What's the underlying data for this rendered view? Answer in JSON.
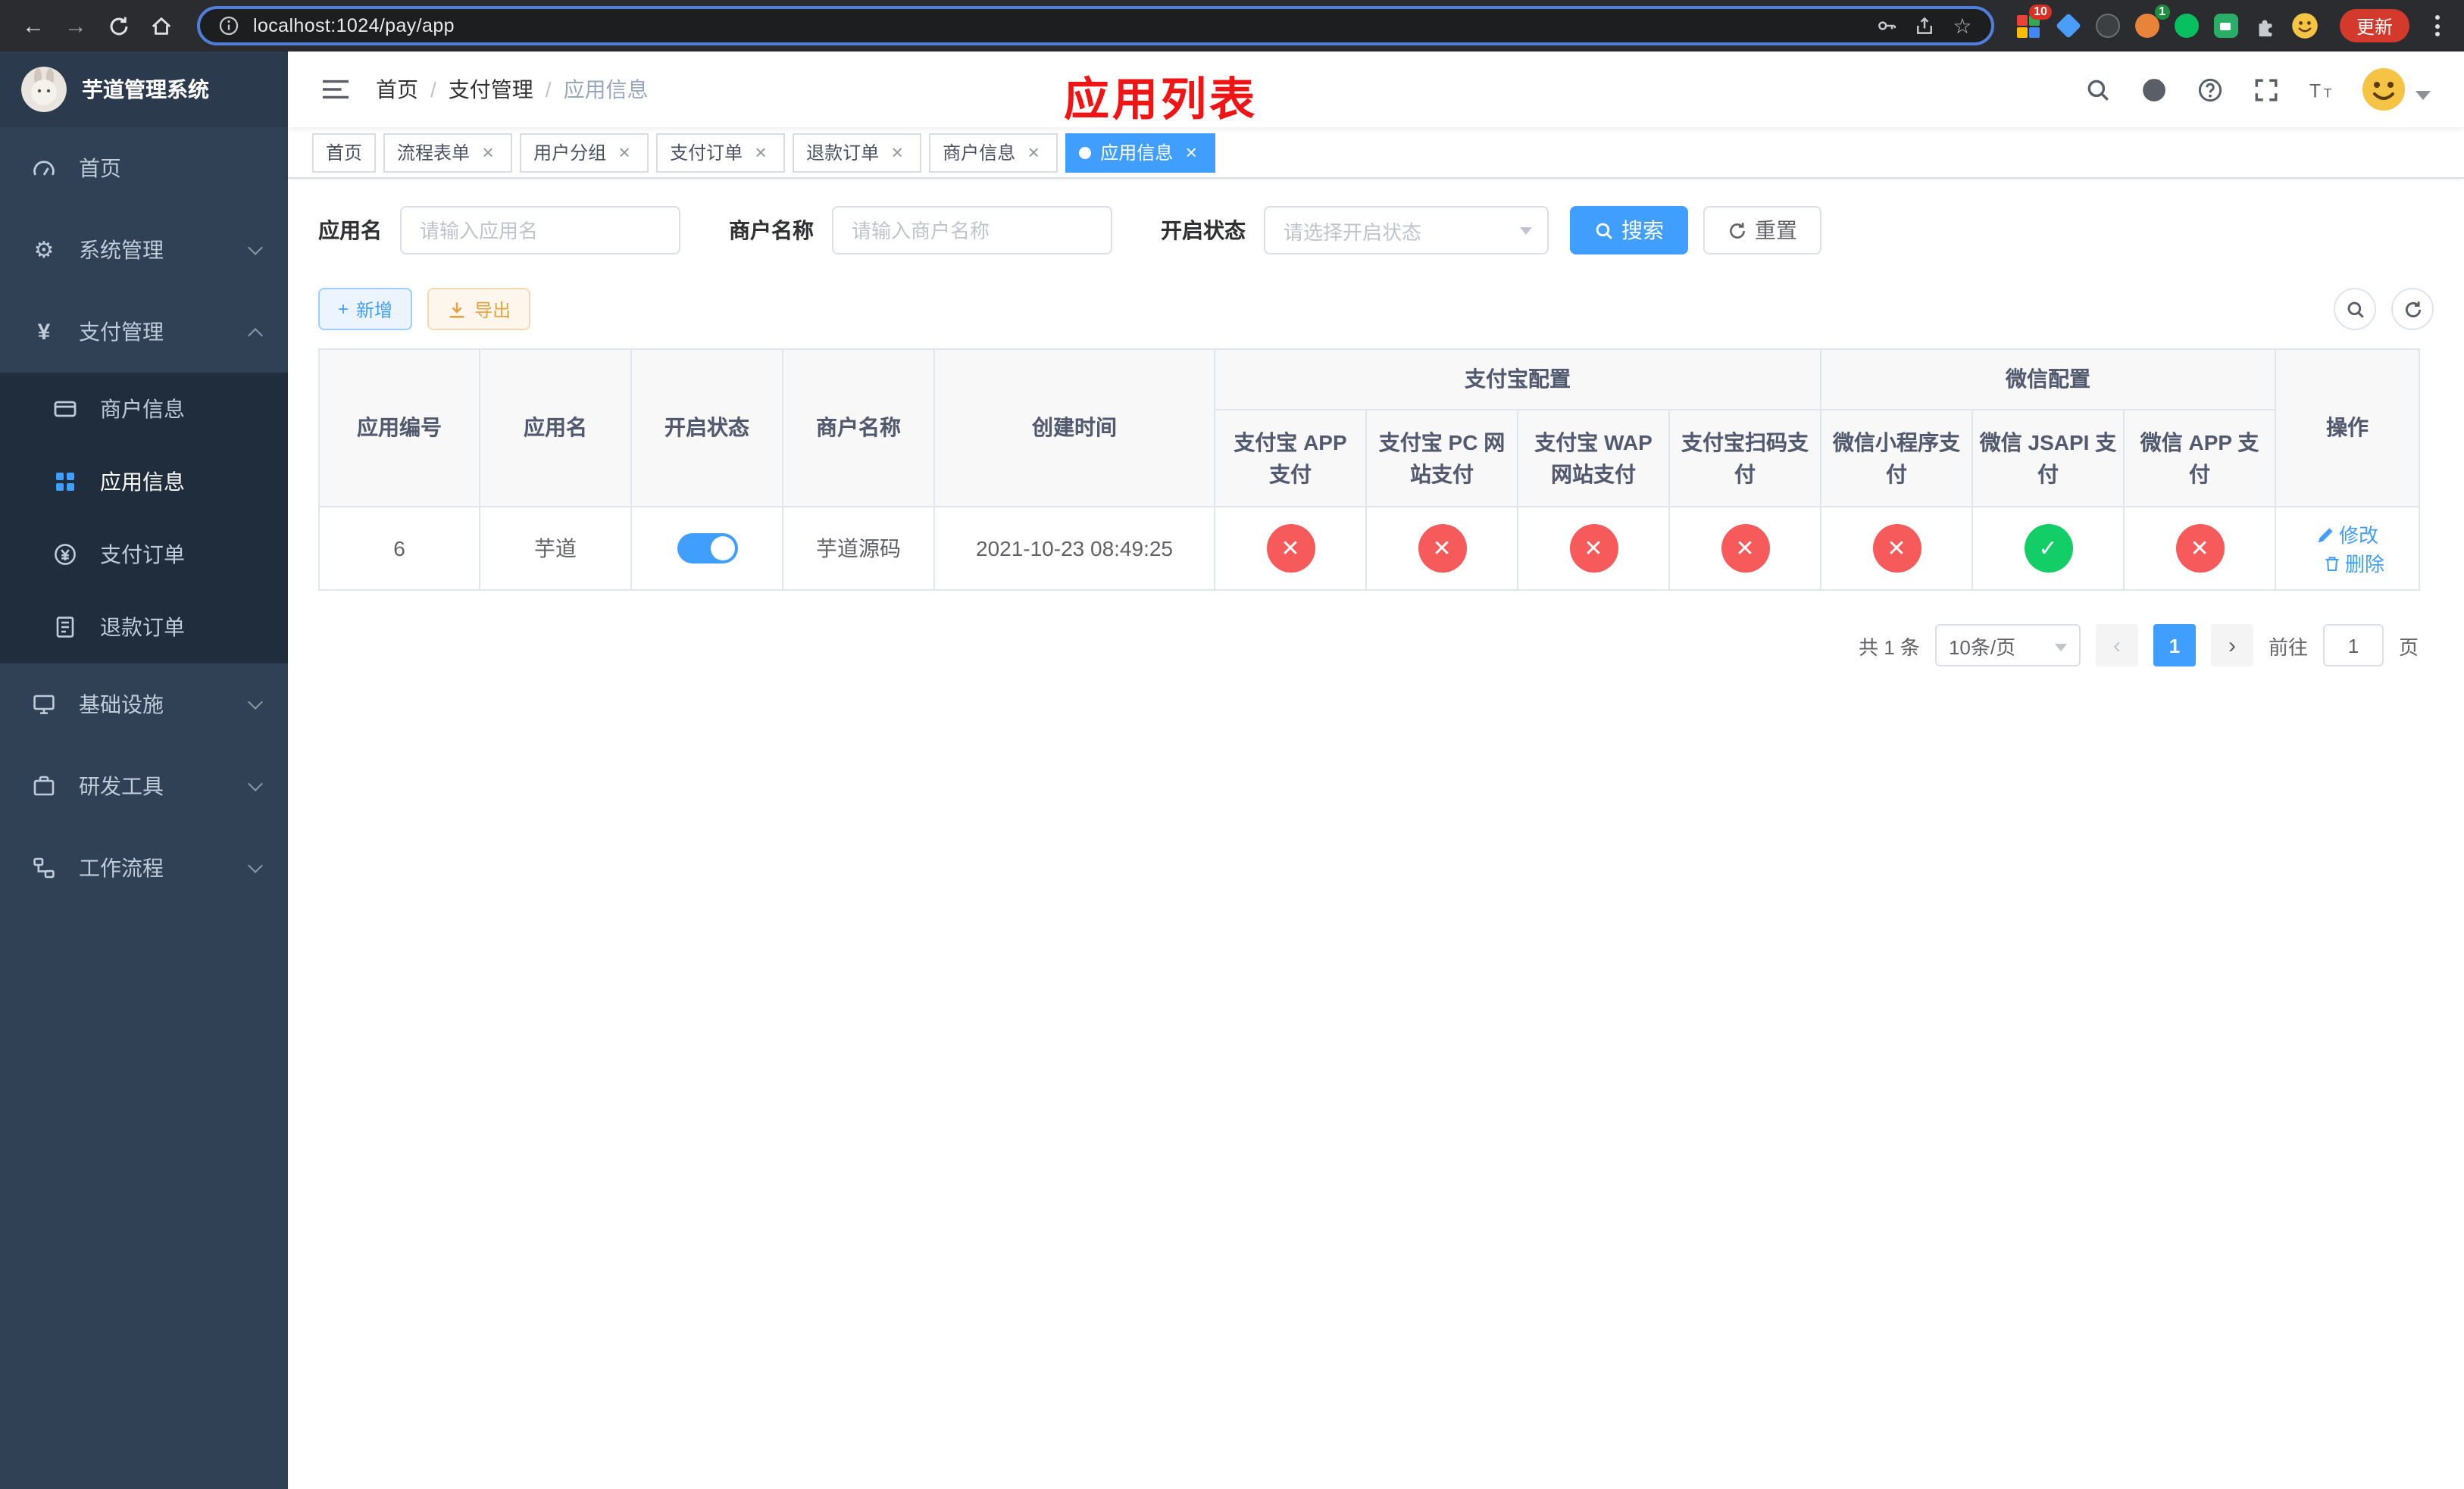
{
  "colors": {
    "accent": "#409eff",
    "danger": "#f75a5a",
    "success": "#13ce66",
    "annotation": "#f01414",
    "sidebar_bg": "#304156",
    "submenu_bg": "#1f2d3d"
  },
  "icons": {
    "close": "×",
    "back": "←",
    "forward": "→",
    "star": "☆",
    "gear": "⚙",
    "yen": "¥",
    "plus": "+",
    "fail": "✕",
    "ok": "✓",
    "sep": "/",
    "prev": "‹",
    "next": "›"
  },
  "browser": {
    "url": "localhost:1024/pay/app",
    "update_label": "更新",
    "ext_badge_grid": "10",
    "ext_badge_avatar": "1"
  },
  "sidebar": {
    "title": "芋道管理系统",
    "items": [
      {
        "label": "首页"
      },
      {
        "label": "系统管理"
      },
      {
        "label": "支付管理"
      },
      {
        "label": "商户信息"
      },
      {
        "label": "应用信息"
      },
      {
        "label": "支付订单"
      },
      {
        "label": "退款订单"
      },
      {
        "label": "基础设施"
      },
      {
        "label": "研发工具"
      },
      {
        "label": "工作流程"
      }
    ]
  },
  "navbar": {
    "breadcrumb": [
      "首页",
      "支付管理",
      "应用信息"
    ],
    "annotation": "应用列表"
  },
  "tabs": [
    {
      "label": "首页"
    },
    {
      "label": "流程表单"
    },
    {
      "label": "用户分组"
    },
    {
      "label": "支付订单"
    },
    {
      "label": "退款订单"
    },
    {
      "label": "商户信息"
    },
    {
      "label": "应用信息"
    }
  ],
  "filters": {
    "app_name": {
      "label": "应用名",
      "placeholder": "请输入应用名",
      "value": ""
    },
    "merchant_name": {
      "label": "商户名称",
      "placeholder": "请输入商户名称",
      "value": ""
    },
    "status": {
      "label": "开启状态",
      "placeholder": "请选择开启状态",
      "value": ""
    },
    "search_label": "搜索",
    "reset_label": "重置"
  },
  "toolbar": {
    "add_label": "新增",
    "export_label": "导出"
  },
  "table": {
    "group_headers": {
      "alipay": "支付宝配置",
      "wechat": "微信配置"
    },
    "columns": [
      "应用编号",
      "应用名",
      "开启状态",
      "商户名称",
      "创建时间",
      "支付宝 APP 支付",
      "支付宝 PC 网站支付",
      "支付宝 WAP 网站支付",
      "支付宝扫码支付",
      "微信小程序支付",
      "微信 JSAPI 支付",
      "微信 APP 支付",
      "操作"
    ],
    "row": {
      "id": "6",
      "name": "芋道",
      "status_on": true,
      "merchant": "芋道源码",
      "created_at": "2021-10-23 08:49:25",
      "configs": [
        false,
        false,
        false,
        false,
        false,
        true,
        false
      ],
      "edit_label": "修改",
      "delete_label": "删除"
    }
  },
  "pagination": {
    "total_text": "共 1 条",
    "page_size": "10条/页",
    "current_page": "1",
    "goto_prefix": "前往",
    "goto_value": "1",
    "goto_suffix": "页"
  }
}
